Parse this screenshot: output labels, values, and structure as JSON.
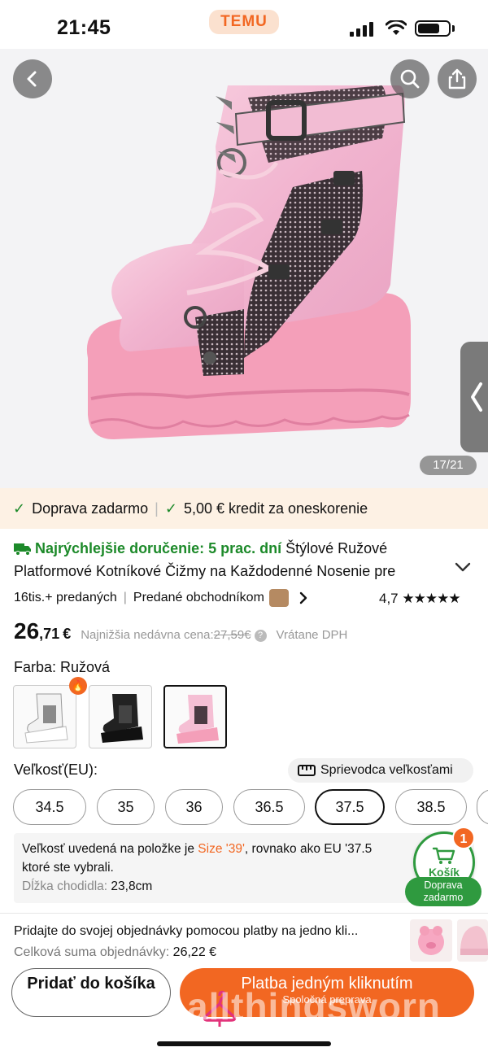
{
  "status_bar": {
    "time": "21:45",
    "app_logo": "TEMU"
  },
  "gallery": {
    "counter": "17/21"
  },
  "banner": {
    "item1": "Doprava zadarmo",
    "item2": "5,00 € kredit za oneskorenie"
  },
  "product": {
    "fast_delivery": "Najrýchlejšie doručenie: 5 prac. dní",
    "title_part1": "Štýlové Ružové",
    "title_line2": "Platformové Kotníkové Čižmy na Každodenné Nosenie pre",
    "sold": "16tis.+ predaných",
    "sold_by": "Predané obchodníkom",
    "rating": "4,7",
    "stars": "★★★★★",
    "price_int": "26",
    "price_dec": ",71",
    "price_currency": "€",
    "lowest_label": "Najnižšia nedávna cena:",
    "lowest_value": "27,59€",
    "vat": "Vrátane DPH"
  },
  "color": {
    "label": "Farba: Ružová",
    "options": [
      "white",
      "black",
      "pink"
    ],
    "selected_index": 2
  },
  "size": {
    "label": "Veľkosť(EU):",
    "guide": "Sprievodca veľkosťami",
    "options": [
      "34.5",
      "35",
      "36",
      "36.5",
      "37.5",
      "38.5"
    ],
    "selected": "37.5",
    "info_prefix": "Veľkosť uvedená na položke je ",
    "info_size": "Size '39'",
    "info_suffix": ", rovnako ako EU '37.5",
    "info_line2": "ktoré ste vybrali.",
    "foot_label": "Dĺžka chodidla:",
    "foot_value": "23,8cm"
  },
  "cart": {
    "label": "Košík",
    "count": "1",
    "free_shipping": "Doprava zadarmo"
  },
  "promo": {
    "line1": "Pridajte do svojej objednávky pomocou platby na jedno kli...",
    "total_label": "Celková suma objednávky:",
    "total_value": "26,22 €"
  },
  "actions": {
    "add_to_cart": "Pridať do košíka",
    "buy_now": "Platba jedným kliknutím",
    "buy_now_sub": "Spoločná preprava"
  },
  "watermark": "allthingsworn",
  "colors": {
    "accent": "#f26722",
    "green": "#1d8a2a",
    "pink": "#f4a6c0"
  }
}
